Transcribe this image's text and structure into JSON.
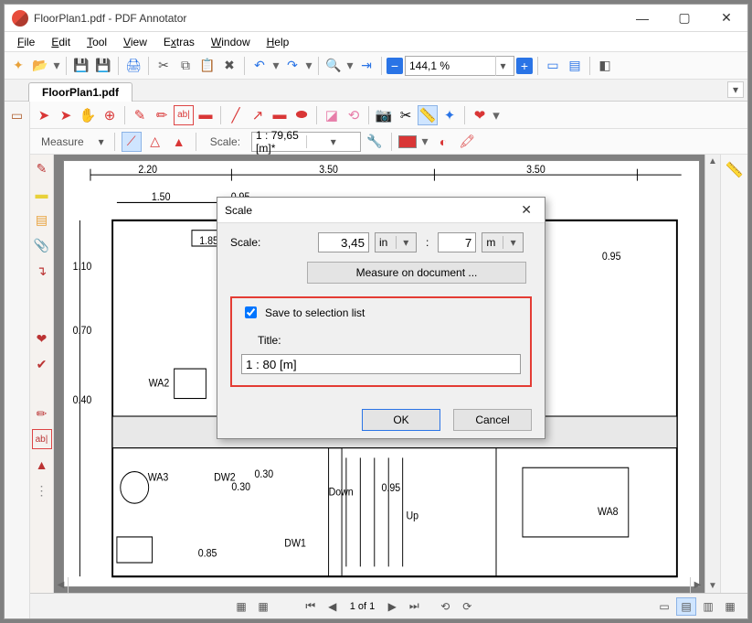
{
  "app": {
    "title": "FloorPlan1.pdf - PDF Annotator"
  },
  "menu": {
    "file": "File",
    "edit": "Edit",
    "tool": "Tool",
    "view": "View",
    "extras": "Extras",
    "window": "Window",
    "help": "Help"
  },
  "zoom": {
    "value": "144,1 %"
  },
  "tab": {
    "name": "FloorPlan1.pdf"
  },
  "subbar": {
    "label": "Measure",
    "scale_label": "Scale:",
    "scale_value": "1 : 79,65 [m]*"
  },
  "statusbar": {
    "page": "1 of 1"
  },
  "dialog": {
    "title": "Scale",
    "scale_label": "Scale:",
    "scale_value": "3,45",
    "unit1": "in",
    "colon": ":",
    "scale_value2": "7",
    "unit2": "m",
    "measure_btn": "Measure on document ...",
    "save_label": "Save to selection list",
    "title_label": "Title:",
    "title_value": "1 : 80 [m]",
    "ok": "OK",
    "cancel": "Cancel"
  },
  "plan": {
    "dim_220": "2.20",
    "dim_350a": "3.50",
    "dim_350b": "3.50",
    "dim_150": "1.50",
    "dim_095a": "0.95",
    "dim_185": "1.85",
    "dim_110": "1.10",
    "dim_070": "0.70",
    "dim_040": "0.40",
    "dim_085": "0.85",
    "dim_030a": "0.30",
    "dim_030b": "0.30",
    "dim_095b": "0.95",
    "dim_095c": "0.95",
    "down": "Down",
    "up": "Up",
    "wa2": "WA2",
    "wa3": "WA3",
    "wa8": "WA8",
    "dw1": "DW1",
    "dw2": "DW2"
  }
}
